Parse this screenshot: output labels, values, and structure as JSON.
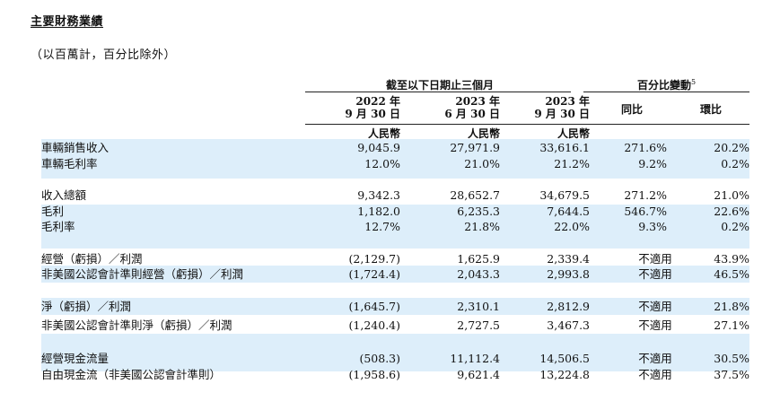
{
  "title": "主要財務業績",
  "unit_note": "（以百萬計，百分比除外）",
  "group_headers": {
    "period": "截至以下日期止三個月",
    "change": "百分比變動",
    "change_note": "5"
  },
  "columns": [
    {
      "line1": "2022 年",
      "line2": "9 月 30 日",
      "currency": "人民幣"
    },
    {
      "line1": "2023 年",
      "line2": "6 月 30 日",
      "currency": "人民幣"
    },
    {
      "line1": "2023 年",
      "line2": "9 月 30 日",
      "currency": "人民幣"
    },
    {
      "line1": "同比",
      "line2": "",
      "currency": ""
    },
    {
      "line1": "環比",
      "line2": "",
      "currency": ""
    }
  ],
  "rows": [
    {
      "label": "車輛銷售收入",
      "values": [
        "9,045.9",
        "27,971.9",
        "33,616.1",
        "271.6%",
        "20.2%"
      ]
    },
    {
      "label": "車輛毛利率",
      "values": [
        "12.0%",
        "21.0%",
        "21.2%",
        "9.2%",
        "0.2%"
      ]
    },
    {
      "label": "收入總額",
      "values": [
        "9,342.3",
        "28,652.7",
        "34,679.5",
        "271.2%",
        "21.0%"
      ]
    },
    {
      "label": "毛利",
      "values": [
        "1,182.0",
        "6,235.3",
        "7,644.5",
        "546.7%",
        "22.6%"
      ]
    },
    {
      "label": "毛利率",
      "values": [
        "12.7%",
        "21.8%",
        "22.0%",
        "9.3%",
        "0.2%"
      ]
    },
    {
      "label": "經營（虧損）／利潤",
      "values": [
        "(2,129.7)",
        "1,625.9",
        "2,339.4",
        "不適用",
        "43.9%"
      ]
    },
    {
      "label": "非美國公認會計準則經營（虧損）／利潤",
      "values": [
        "(1,724.4)",
        "2,043.3",
        "2,993.8",
        "不適用",
        "46.5%"
      ]
    },
    {
      "label": "淨（虧損）／利潤",
      "values": [
        "(1,645.7)",
        "2,310.1",
        "2,812.9",
        "不適用",
        "21.8%"
      ]
    },
    {
      "label": "非美國公認會計準則淨（虧損）／利潤",
      "values": [
        "(1,240.4)",
        "2,727.5",
        "3,467.3",
        "不適用",
        "27.1%"
      ]
    },
    {
      "label": "經營現金流量",
      "values": [
        "(508.3)",
        "11,112.4",
        "14,506.5",
        "不適用",
        "30.5%"
      ]
    },
    {
      "label": "自由現金流（非美國公認會計準則）",
      "values": [
        "(1,958.6)",
        "9,621.4",
        "13,224.8",
        "不適用",
        "37.5%"
      ]
    }
  ]
}
